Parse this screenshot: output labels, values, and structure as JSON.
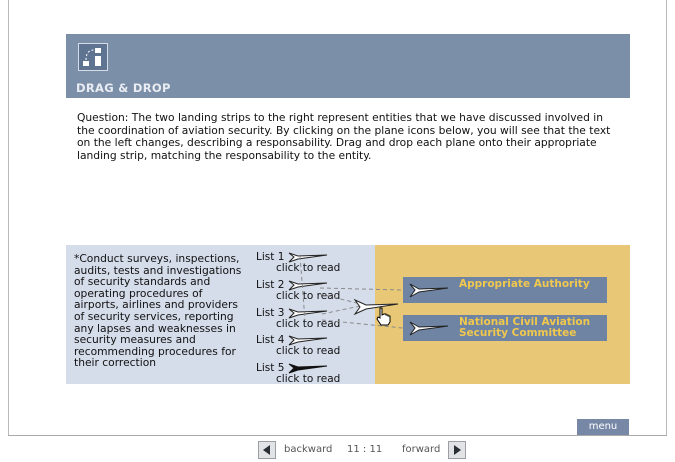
{
  "header": {
    "title": "DRAG & DROP",
    "logo_icon": "drag-drop-icon"
  },
  "question": {
    "text": "Question: The two landing strips to the right represent entities that we have discussed involved in the coordination of aviation security. By clicking on the plane icons below, you will see that the text on the left changes, describing a responsability. Drag and drop each plane onto their appropriate landing strip, matching the responsability to the entity."
  },
  "responsibility": {
    "text": "*Conduct surveys, inspections, audits, tests and investigations of security standards and operating procedures of airports, airlines and providers of security services, reporting any lapses and weaknesses in security measures and recommending procedures for their correction"
  },
  "lists": [
    {
      "label": "List 1",
      "action": "click to read",
      "plane_icon": "plane-outline-icon"
    },
    {
      "label": "List 2",
      "action": "click to read",
      "plane_icon": "plane-outline-icon"
    },
    {
      "label": "List 3",
      "action": "click to read",
      "plane_icon": "plane-outline-icon"
    },
    {
      "label": "List 4",
      "action": "click to read",
      "plane_icon": "plane-outline-icon"
    },
    {
      "label": "List 5",
      "action": "click to read",
      "plane_icon": "plane-filled-icon"
    }
  ],
  "strips": [
    {
      "label": "Appropriate Authority",
      "plane_icon": "plane-outline-icon"
    },
    {
      "label": "National Civil Aviation Security Committee",
      "plane_icon": "plane-outline-icon"
    }
  ],
  "footer": {
    "menu_label": "menu",
    "backward_label": "backward",
    "page_indicator": "11 : 11",
    "forward_label": "forward"
  },
  "colors": {
    "banner": "#7c8fa8",
    "left_panel": "#d5dcea",
    "right_panel": "#e8c876",
    "strip": "#6f84a2",
    "strip_text": "#f1c84e"
  }
}
